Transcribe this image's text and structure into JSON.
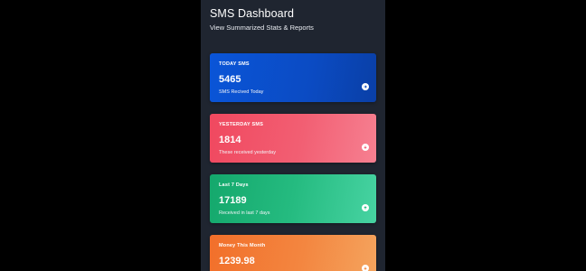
{
  "header": {
    "title": "SMS Dashboard",
    "subtitle": "View Summarized Stats & Reports"
  },
  "cards": [
    {
      "label": "TODAY SMS",
      "value": "5465",
      "description": "SMS Recived Today",
      "icon": "arrow-right-circle-icon",
      "color": "#0b4bc3"
    },
    {
      "label": "YESTERDAY SMS",
      "value": "1814",
      "description": "These received yesterday",
      "icon": "arrow-down-circle-icon",
      "color": "#f25f73"
    },
    {
      "label": "Last 7 Days",
      "value": "17189",
      "description": "Received in last 7 days",
      "icon": "arrow-up-circle-icon",
      "color": "#25bb80"
    },
    {
      "label": "Money This Month",
      "value": "1239.98",
      "description": "",
      "icon": "arrow-down-circle-icon",
      "color": "#f38640"
    }
  ]
}
